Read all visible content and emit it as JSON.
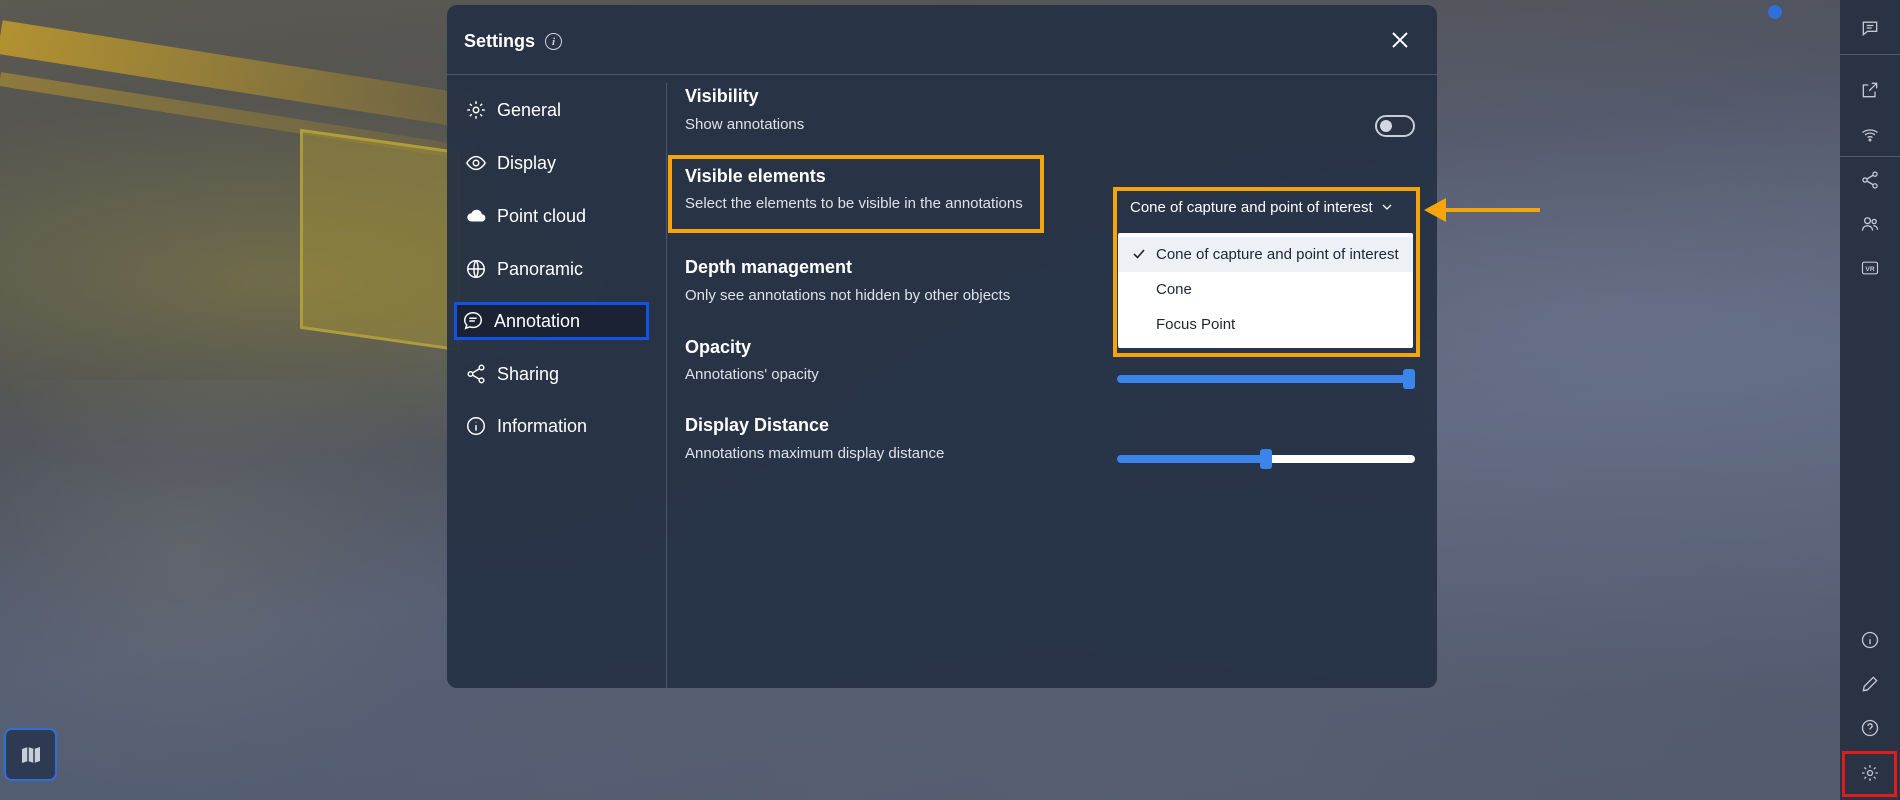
{
  "dialog": {
    "title": "Settings",
    "close_icon": "close-icon",
    "info_icon": "info-icon"
  },
  "nav": {
    "items": [
      {
        "label": "General",
        "icon": "gear-icon"
      },
      {
        "label": "Display",
        "icon": "eye-icon"
      },
      {
        "label": "Point cloud",
        "icon": "cloud-icon"
      },
      {
        "label": "Panoramic",
        "icon": "globe-icon"
      },
      {
        "label": "Annotation",
        "icon": "comment-icon",
        "active": true
      },
      {
        "label": "Sharing",
        "icon": "share-icon"
      },
      {
        "label": "Information",
        "icon": "info-icon"
      }
    ]
  },
  "sections": {
    "visibility": {
      "title": "Visibility",
      "desc": "Show annotations",
      "toggle_on": false
    },
    "visible_elements": {
      "title": "Visible elements",
      "desc": "Select the elements to be visible in the annotations",
      "selected": "Cone of capture and point of interest",
      "options": [
        "Cone of capture and point of interest",
        "Cone",
        "Focus Point"
      ]
    },
    "depth": {
      "title": "Depth management",
      "desc": "Only see annotations not hidden by other objects"
    },
    "opacity": {
      "title": "Opacity",
      "desc": "Annotations' opacity",
      "value": 1.0
    },
    "distance": {
      "title": "Display Distance",
      "desc": "Annotations maximum display distance",
      "value": 0.5
    }
  },
  "right_toolbar": {
    "icons": [
      "comment-icon",
      "external-link-icon",
      "wifi-icon",
      "share-icon",
      "users-icon",
      "vr-icon",
      "info-icon",
      "pencil-icon",
      "help-icon",
      "gear-icon"
    ],
    "vr_label": "VR"
  },
  "map_button": {
    "icon": "map-icon"
  },
  "colors": {
    "highlight_orange": "#f5a50b",
    "highlight_blue": "#1253e6",
    "highlight_red": "#e21c1c",
    "slider_blue": "#3a84ea"
  }
}
